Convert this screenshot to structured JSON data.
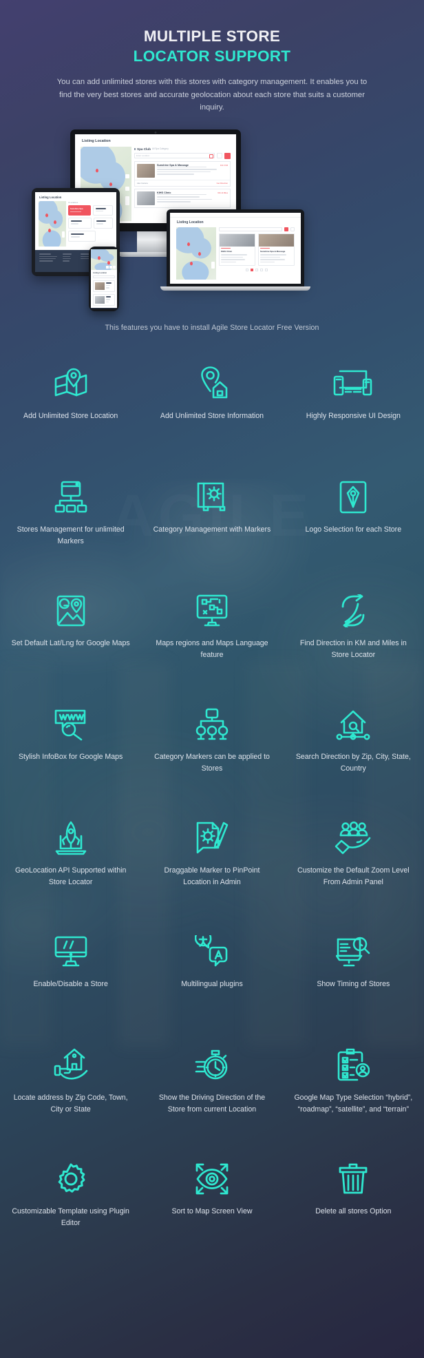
{
  "header": {
    "title_line1": "MULTIPLE STORE",
    "title_line2": "LOCATOR SUPPORT",
    "subtitle": "You can add unlimited stores with this stores with category management. It enables you to find the very best stores and accurate geolocation about each store that suits a customer inquiry.",
    "accent_color": "#2fe8d0",
    "title_color": "#f0f0f4"
  },
  "mockup": {
    "desktop_screen_title": "Listing Location",
    "desktop_panel_title": "Spa Club",
    "desktop_panel_subtitle": "All Spa Category",
    "desktop_search_placeholder": "Enter Location",
    "desktop_store_1_name": "Sunshine Spa & Massage",
    "desktop_store_1_badge": "941.9 KM",
    "desktop_store_2_name": "KIHS Clinic",
    "desktop_store_2_badge": "934.14 Miles",
    "desktop_store_owner": "Alex Carrera",
    "desktop_store_cta": "Get Direction",
    "tablet_screen_title": "Listing Location",
    "tablet_card_title": "Sunshine Spa",
    "laptop_screen_title": "Listing Location",
    "laptop_store_1_name": "KIHS Clinic",
    "laptop_store_2_name": "Sunshine Spa & Massage",
    "phone_screen_title": "Listing Location"
  },
  "install_note": "This features you have to install  Agile Store Locator Free Version",
  "features": [
    {
      "icon": "map-pin-location-icon",
      "label": "Add Unlimited Store Location"
    },
    {
      "icon": "pin-store-info-icon",
      "label": "Add Unlimited Store Information"
    },
    {
      "icon": "responsive-devices-icon",
      "label": "Highly Responsive UI Design"
    },
    {
      "icon": "sitemap-stores-icon",
      "label": "Stores Management for unlimited Markers"
    },
    {
      "icon": "map-gear-category-icon",
      "label": "Category Management with Markers"
    },
    {
      "icon": "pen-nib-logo-icon",
      "label": "Logo Selection for each Store"
    },
    {
      "icon": "google-maps-latlng-icon",
      "label": "Set Default Lat/Lng for Google Maps"
    },
    {
      "icon": "monitor-regions-icon",
      "label": "Maps regions and Maps Language feature"
    },
    {
      "icon": "direction-arrows-icon",
      "label": "Find Direction in KM and Miles in Store Locator"
    },
    {
      "icon": "www-search-infobox-icon",
      "label": "Stylish InfoBox for Google Maps"
    },
    {
      "icon": "category-markers-tree-icon",
      "label": "Category Markers can be applied to Stores"
    },
    {
      "icon": "house-search-direction-icon",
      "label": "Search Direction by Zip, City, State, Country"
    },
    {
      "icon": "rocket-laptop-geolocation-icon",
      "label": "GeoLocation API Supported within Store Locator"
    },
    {
      "icon": "document-gear-pencil-icon",
      "label": "Draggable Marker to PinPoint Location in Admin"
    },
    {
      "icon": "hand-users-zoom-icon",
      "label": "Customize the Default Zoom Level From Admin Panel"
    },
    {
      "icon": "monitor-toggle-icon",
      "label": "Enable/Disable a Store"
    },
    {
      "icon": "translate-bubbles-icon",
      "label": "Multilingual plugins"
    },
    {
      "icon": "monitor-clock-search-icon",
      "label": "Show Timing of Stores"
    },
    {
      "icon": "hand-house-address-icon",
      "label": "Locate address by Zip Code, Town, City or State"
    },
    {
      "icon": "stopwatch-driving-icon",
      "label": "Show the Driving Direction of the Store from current Location"
    },
    {
      "icon": "clipboard-checklist-map-type-icon",
      "label": "Google Map Type Selection “hybrid”, “roadmap”, “satellite”, and “terrain”"
    },
    {
      "icon": "gear-template-editor-icon",
      "label": "Customizable Template using Plugin Editor"
    },
    {
      "icon": "eye-expand-screen-icon",
      "label": "Sort to Map Screen View"
    },
    {
      "icon": "trash-delete-icon",
      "label": "Delete all stores Option"
    }
  ],
  "watermark": "AGILE"
}
